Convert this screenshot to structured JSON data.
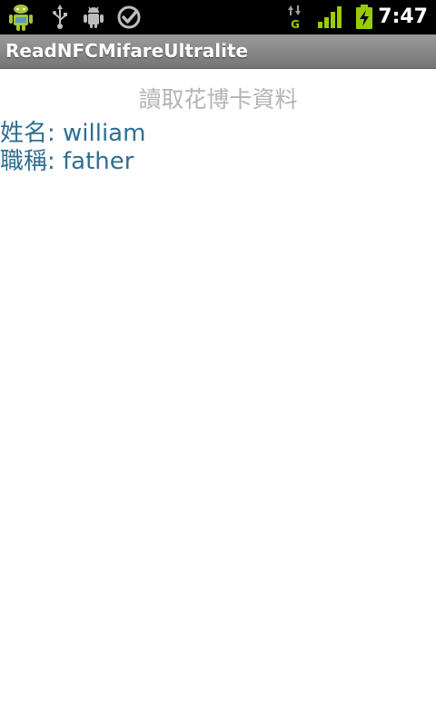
{
  "status_bar": {
    "time": "7:47",
    "icons": [
      "android-notification-icon",
      "usb-icon",
      "debug-icon",
      "task-check-icon",
      "gprs-data-icon",
      "signal-strength-icon",
      "battery-charging-icon"
    ],
    "accent_color": "#99cc00"
  },
  "app": {
    "title": "ReadNFCMifareUltralite"
  },
  "main": {
    "heading": "讀取花博卡資料",
    "name_line": "姓名: william",
    "title_line": "職稱: father",
    "text_color": "#2e6f93",
    "heading_color": "#b4b4b4"
  }
}
